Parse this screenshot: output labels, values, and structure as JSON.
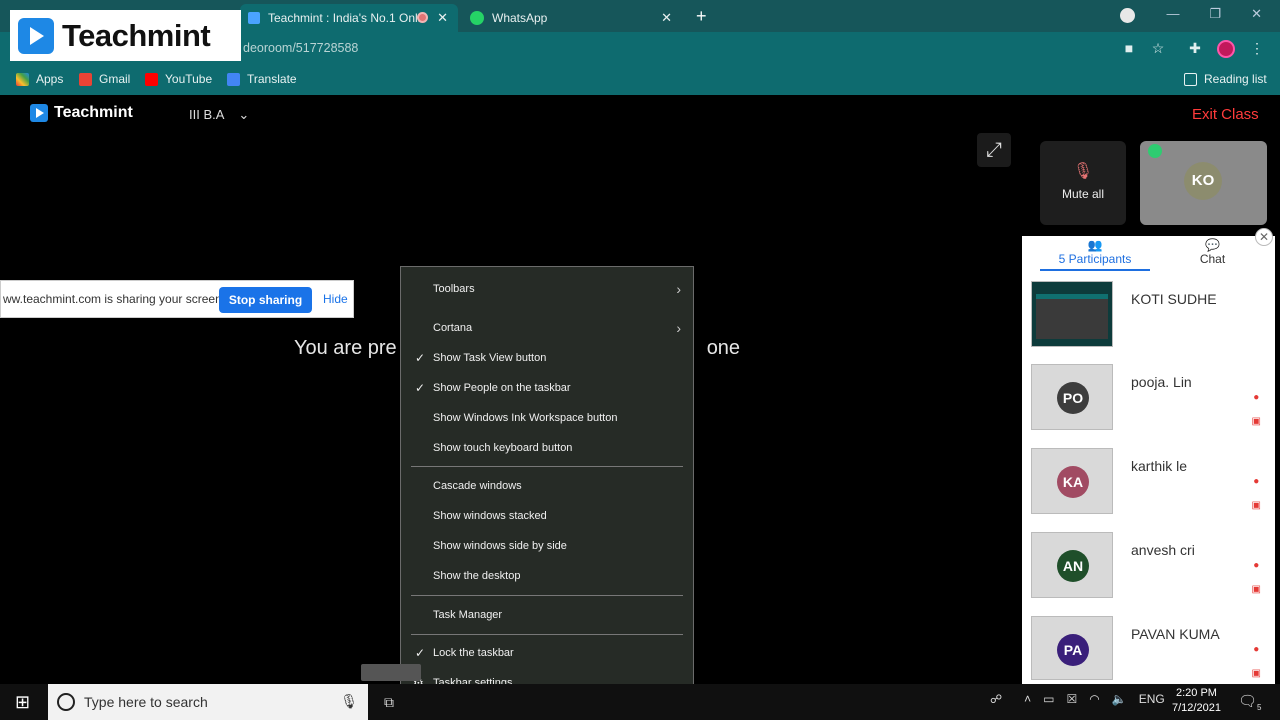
{
  "browser": {
    "tabs": [
      {
        "title": "Teachmint : India's No.1 Onli"
      },
      {
        "title": "WhatsApp"
      }
    ],
    "new_tab": "+",
    "url": "deoroom/517728588",
    "bookmarks": [
      "Apps",
      "Gmail",
      "YouTube",
      "Translate"
    ],
    "reading_list": "Reading list"
  },
  "watermark": {
    "brand": "Teachmint"
  },
  "app": {
    "brand": "Teachmint",
    "class_name": "III B.A",
    "exit_label": "Exit Class",
    "presenting_text_left": "You are pre",
    "presenting_text_right": "one"
  },
  "tiles": {
    "mute_all": "Mute all",
    "host_initials": "KO"
  },
  "share_bar": {
    "text": "ww.teachmint.com is sharing your screen.",
    "stop": "Stop sharing",
    "hide": "Hide"
  },
  "panel": {
    "tab_participants": "5 Participants",
    "tab_chat": "Chat",
    "participants": [
      {
        "name": "KOTI SUDHE",
        "initials": "",
        "color": ""
      },
      {
        "name": "pooja. Lin",
        "initials": "PO",
        "color": "#3d3d3d"
      },
      {
        "name": "karthik le",
        "initials": "KA",
        "color": "#a14b63"
      },
      {
        "name": "anvesh cri",
        "initials": "AN",
        "color": "#1f4f2a"
      },
      {
        "name": "PAVAN KUMA",
        "initials": "PA",
        "color": "#3a1f7a"
      }
    ]
  },
  "context_menu": {
    "items": [
      {
        "label": "Toolbars",
        "checked": false,
        "submenu": true
      },
      {
        "label": "Cortana",
        "checked": false,
        "submenu": true
      },
      {
        "label": "Show Task View button",
        "checked": true,
        "submenu": false
      },
      {
        "label": "Show People on the taskbar",
        "checked": true,
        "submenu": false
      },
      {
        "label": "Show Windows Ink Workspace button",
        "checked": false,
        "submenu": false
      },
      {
        "label": "Show touch keyboard button",
        "checked": false,
        "submenu": false
      },
      {
        "label": "Cascade windows",
        "checked": false,
        "submenu": false
      },
      {
        "label": "Show windows stacked",
        "checked": false,
        "submenu": false
      },
      {
        "label": "Show windows side by side",
        "checked": false,
        "submenu": false
      },
      {
        "label": "Show the desktop",
        "checked": false,
        "submenu": false
      },
      {
        "label": "Task Manager",
        "checked": false,
        "submenu": false
      },
      {
        "label": "Lock the taskbar",
        "checked": true,
        "submenu": false
      },
      {
        "label": "Taskbar settings",
        "checked": false,
        "submenu": false
      }
    ]
  },
  "taskbar": {
    "search_placeholder": "Type here to search",
    "language": "ENG",
    "time": "2:20 PM",
    "date": "7/12/2021",
    "notification_count": "5"
  }
}
